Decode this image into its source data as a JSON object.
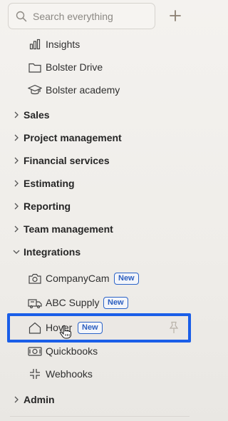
{
  "search": {
    "placeholder": "Search everything"
  },
  "sidebar": {
    "top_items": [
      {
        "label": "Insights",
        "icon": "bar-chart-icon"
      },
      {
        "label": "Bolster Drive",
        "icon": "folder-icon"
      },
      {
        "label": "Bolster academy",
        "icon": "graduation-cap-icon"
      }
    ],
    "sections": [
      {
        "label": "Sales",
        "expanded": false
      },
      {
        "label": "Project management",
        "expanded": false
      },
      {
        "label": "Financial services",
        "expanded": false
      },
      {
        "label": "Estimating",
        "expanded": false
      },
      {
        "label": "Reporting",
        "expanded": false
      },
      {
        "label": "Team management",
        "expanded": false
      },
      {
        "label": "Integrations",
        "expanded": true
      }
    ],
    "integrations": [
      {
        "label": "CompanyCam",
        "badge": "New",
        "icon": "camera-icon"
      },
      {
        "label": "ABC Supply",
        "badge": "New",
        "icon": "supply-truck-icon"
      },
      {
        "label": "Hover",
        "badge": "New",
        "icon": "house-icon",
        "hovered": true
      },
      {
        "label": "Quickbooks",
        "icon": "money-icon"
      },
      {
        "label": "Webhooks",
        "icon": "webhook-icon"
      }
    ],
    "admin": {
      "label": "Admin"
    }
  },
  "colors": {
    "accent_blue": "#1a5ee8",
    "badge_blue": "#2c5fc0",
    "sidebar_bg": "#f2f0ed"
  }
}
